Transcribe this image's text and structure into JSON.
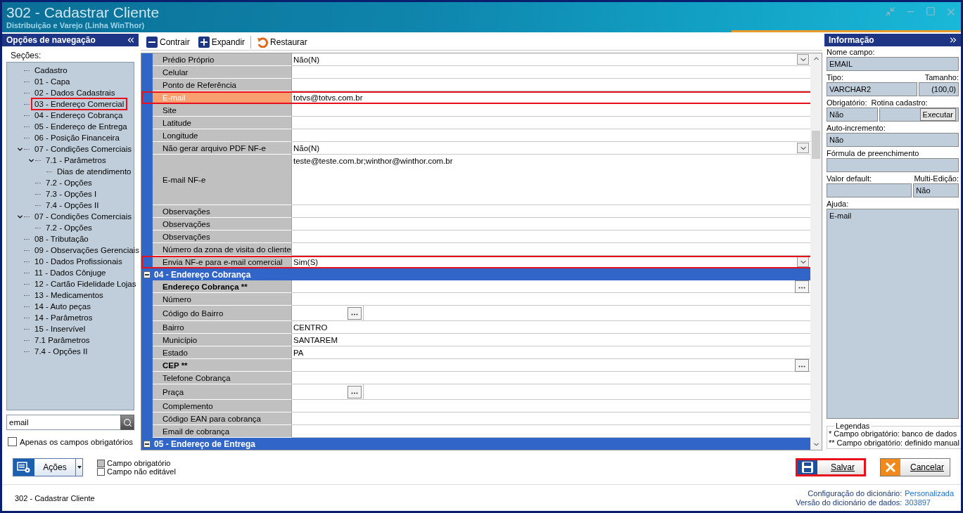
{
  "window": {
    "title": "302 - Cadastrar Cliente",
    "subtitle": "Distribuição e Varejo (Linha WinThor)"
  },
  "navigation": {
    "title": "Opções de navegação",
    "sections_label": "Seções:",
    "tree": [
      {
        "label": "Cadastro",
        "highlighted": false
      },
      {
        "label": "01 - Capa",
        "highlighted": false
      },
      {
        "label": "02 - Dados Cadastrais",
        "highlighted": false
      },
      {
        "label": "03 - Endereço Comercial",
        "highlighted": true
      },
      {
        "label": "04 - Endereço Cobrança",
        "highlighted": false
      },
      {
        "label": "05 - Endereço de Entrega",
        "highlighted": false
      },
      {
        "label": "06 - Posição Financeira",
        "highlighted": false
      },
      {
        "label": "07 - Condições Comerciais",
        "highlighted": false,
        "expanded": true,
        "children": [
          {
            "label": "7.1 - Parâmetros",
            "highlighted": false,
            "expanded": true,
            "children": [
              {
                "label": "Dias de atendimento",
                "highlighted": false
              }
            ]
          },
          {
            "label": "7.2 - Opções",
            "highlighted": false
          },
          {
            "label": "7.3 - Opções I",
            "highlighted": false
          },
          {
            "label": "7.4 - Opções II",
            "highlighted": false
          }
        ]
      },
      {
        "label": "07 - Condições Comerciais",
        "highlighted": false,
        "expanded": true,
        "children": [
          {
            "label": "7.2 - Opções",
            "highlighted": false
          }
        ]
      },
      {
        "label": "08 - Tributação",
        "highlighted": false
      },
      {
        "label": "09 - Observações Gerenciais",
        "highlighted": false
      },
      {
        "label": "10 - Dados Profissionais",
        "highlighted": false
      },
      {
        "label": "11 - Dados Cônjuge",
        "highlighted": false
      },
      {
        "label": "12 - Cartão Fidelidade Lojas",
        "highlighted": false
      },
      {
        "label": "13 - Medicamentos",
        "highlighted": false
      },
      {
        "label": "14 - Auto peças",
        "highlighted": false
      },
      {
        "label": "14 - Parâmetros",
        "highlighted": false
      },
      {
        "label": "15 - Inservível",
        "highlighted": false
      },
      {
        "label": "7.1 Parâmetros",
        "highlighted": false
      },
      {
        "label": "7.4 - Opções II",
        "highlighted": false
      }
    ],
    "search": {
      "value": "email"
    },
    "required_only": {
      "label": "Apenas os campos obrigatórios",
      "checked": false
    }
  },
  "toolbar": [
    {
      "label": "Contrair",
      "kind": "collapse"
    },
    {
      "label": "Expandir",
      "kind": "expand"
    },
    {
      "label": "Restaurar",
      "kind": "restore"
    }
  ],
  "grid": {
    "rows": [
      {
        "kind": "dropdown",
        "label": "Prédio Próprio",
        "value": "Não(N)",
        "highlighted": false,
        "focused": false,
        "required": false
      },
      {
        "kind": "text",
        "label": "Celular",
        "highlighted": false,
        "focused": false,
        "required": false
      },
      {
        "kind": "text",
        "label": "Ponto de Referência",
        "highlighted": false,
        "focused": false,
        "required": false
      },
      {
        "kind": "text",
        "label": "E-mail",
        "value": "totvs@totvs.com.br",
        "highlighted": true,
        "focused": true,
        "required": false
      },
      {
        "kind": "text",
        "label": "Site",
        "highlighted": false,
        "focused": false,
        "required": false
      },
      {
        "kind": "text",
        "label": "Latitude",
        "highlighted": false,
        "focused": false,
        "required": false
      },
      {
        "kind": "text",
        "label": "Longitude",
        "highlighted": false,
        "focused": false,
        "required": false
      },
      {
        "kind": "dropdown",
        "label": "Não gerar arquivo PDF NF-e",
        "value": "Não(N)",
        "highlighted": false,
        "focused": false,
        "required": false
      },
      {
        "kind": "memo",
        "label": "E-mail NF-e",
        "value": "teste@teste.com.br;winthor@winthor.com.br",
        "highlighted": false,
        "focused": false,
        "required": false
      },
      {
        "kind": "text",
        "label": "Observações",
        "highlighted": false,
        "focused": false,
        "required": false
      },
      {
        "kind": "text",
        "label": "Observações",
        "highlighted": false,
        "focused": false,
        "required": false
      },
      {
        "kind": "text",
        "label": "Observações",
        "highlighted": false,
        "focused": false,
        "required": false
      },
      {
        "kind": "text",
        "label": "Número da zona de visita do cliente",
        "highlighted": false,
        "focused": false,
        "required": false
      },
      {
        "kind": "dropdown",
        "label": "Envia NF-e para e-mail comercial",
        "value": "Sim(S)",
        "highlighted": true,
        "focused": false,
        "required": false
      },
      {
        "kind": "section",
        "label": "04 - Endereço Cobrança",
        "expanded": true
      },
      {
        "kind": "lookup",
        "label": "Endereço Cobrança **",
        "highlighted": false,
        "focused": false,
        "required": true
      },
      {
        "kind": "text",
        "label": "Número",
        "highlighted": false,
        "focused": false,
        "required": false
      },
      {
        "kind": "picker",
        "label": "Código do Bairro",
        "highlighted": false,
        "focused": false,
        "required": false
      },
      {
        "kind": "text",
        "label": "Bairro",
        "value": "CENTRO",
        "highlighted": false,
        "focused": false,
        "required": false
      },
      {
        "kind": "text",
        "label": "Município",
        "value": "SANTAREM",
        "highlighted": false,
        "focused": false,
        "required": false
      },
      {
        "kind": "text",
        "label": "Estado",
        "value": "PA",
        "highlighted": false,
        "focused": false,
        "required": false
      },
      {
        "kind": "lookup",
        "label": "CEP **",
        "highlighted": false,
        "focused": false,
        "required": true
      },
      {
        "kind": "text",
        "label": "Telefone Cobrança",
        "highlighted": false,
        "focused": false,
        "required": false
      },
      {
        "kind": "picker",
        "label": "Praça",
        "highlighted": false,
        "focused": false,
        "required": false
      },
      {
        "kind": "text",
        "label": "Complemento",
        "highlighted": false,
        "focused": false,
        "required": false
      },
      {
        "kind": "text",
        "label": "Código EAN para cobrança",
        "highlighted": false,
        "focused": false,
        "required": false
      },
      {
        "kind": "text",
        "label": "Email de cobrança",
        "highlighted": false,
        "focused": false,
        "required": false
      },
      {
        "kind": "section",
        "label": "05 - Endereço de Entrega",
        "expanded": true
      }
    ]
  },
  "info": {
    "title": "Informação",
    "field_name": {
      "label": "Nome campo:",
      "value": "EMAIL"
    },
    "type": {
      "label": "Tipo:",
      "value": "VARCHAR2"
    },
    "size": {
      "label": "Tamanho:",
      "value": "(100,0)"
    },
    "required": {
      "label": "Obrigatório:",
      "value": "Não"
    },
    "routine": {
      "label": "Rotina cadastro:",
      "button": "Executar"
    },
    "auto_increment": {
      "label": "Auto-incremento:",
      "value": "Não"
    },
    "formula": {
      "label": "Fórmula de preenchimento"
    },
    "default_value": {
      "label": "Valor default:"
    },
    "multi_edit": {
      "label": "Multi-Edição:",
      "value": "Não"
    },
    "help": {
      "label": "Ajuda:",
      "value": "E-mail"
    },
    "legend": {
      "title": "Legendas",
      "lines": [
        "* Campo obrigatório: banco de dados",
        "** Campo obrigatório: definido manual"
      ]
    }
  },
  "actions": {
    "label": "Ações"
  },
  "legend": [
    {
      "label": "Campo obrigatório",
      "kind": "required"
    },
    {
      "label": "Campo não editável",
      "kind": "readonly"
    }
  ],
  "buttons": [
    {
      "label": "Salvar",
      "kind": "save",
      "highlighted": true
    },
    {
      "label": "Cancelar",
      "kind": "cancel",
      "highlighted": false
    }
  ],
  "status_bar": {
    "title": "302 - Cadastrar Cliente",
    "items": [
      {
        "label": "Configuração do dicionário:",
        "value": "Personalizada"
      },
      {
        "label": "Versão do dicionário de dados:",
        "value": "303897"
      }
    ]
  }
}
